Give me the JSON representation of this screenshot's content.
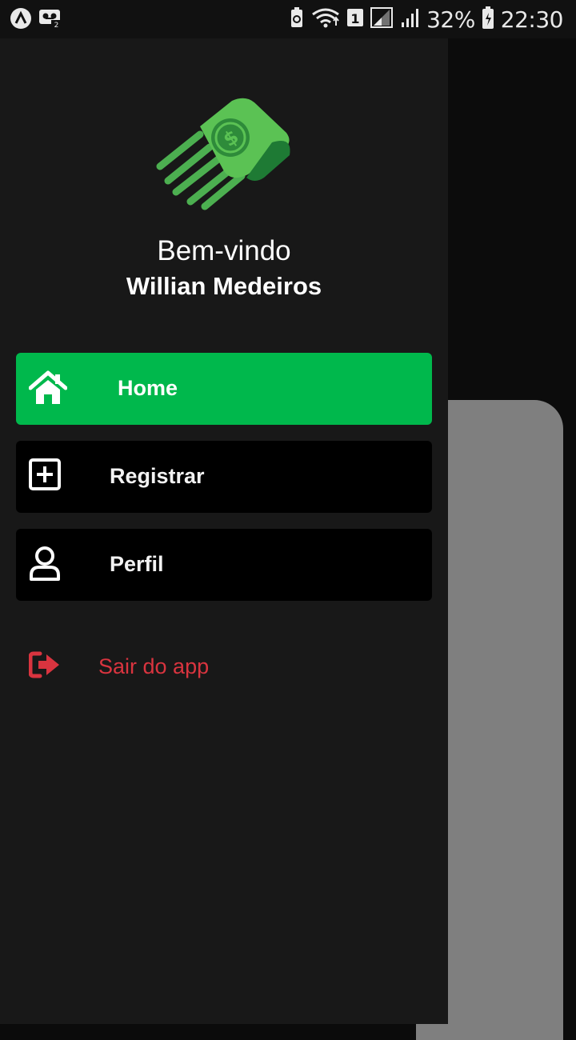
{
  "status_bar": {
    "battery": "32%",
    "time": "22:30",
    "sim_slot": "1",
    "voicemail_count": "2"
  },
  "drawer": {
    "welcome": "Bem-vindo",
    "user_name": "Willian Medeiros",
    "menu": [
      {
        "label": "Home",
        "icon": "home-icon",
        "active": true
      },
      {
        "label": "Registrar",
        "icon": "add-square-icon",
        "active": false
      },
      {
        "label": "Perfil",
        "icon": "user-icon",
        "active": false
      }
    ],
    "logout_label": "Sair do app"
  },
  "colors": {
    "accent": "#00b84c",
    "drawer_bg": "#181818",
    "logout": "#d9343f"
  }
}
